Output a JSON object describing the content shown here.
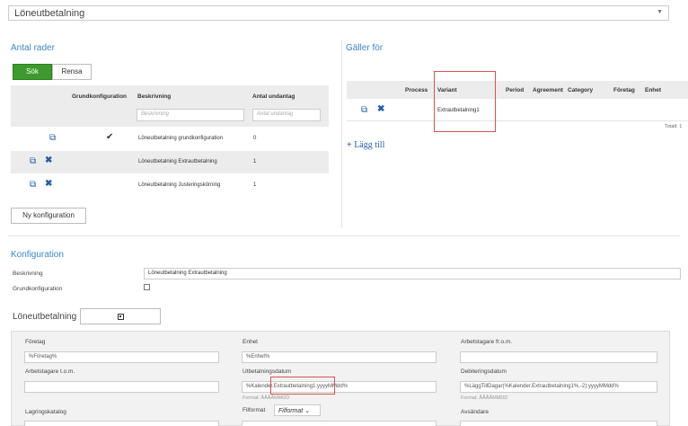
{
  "top_select": {
    "value": "Löneutbetalning"
  },
  "antal": {
    "title": "Antal rader",
    "search_label": "Sök",
    "clear_label": "Rensa",
    "headers": [
      "Grundkonfiguration",
      "Beskrivning",
      "Antal undantag"
    ],
    "placeholders": {
      "beskrivning": "Beskrivning",
      "antal": "Antal undantag"
    },
    "rows": [
      {
        "desc": "Löneutbetalning grundkonfiguration",
        "count": "0",
        "checked": true,
        "deletable": false
      },
      {
        "desc": "Löneutbetalning Extrautbetalning",
        "count": "1",
        "checked": false,
        "deletable": true
      },
      {
        "desc": "Löneutbetalning Justeringskörning",
        "count": "1",
        "checked": false,
        "deletable": true
      }
    ],
    "new_config_label": "Ny konfiguration"
  },
  "galler": {
    "title": "Gäller för",
    "headers": [
      "Process",
      "Variant",
      "Period",
      "Agreement",
      "Category",
      "Företag",
      "Enhet"
    ],
    "row_variant": "Extrautbetalning1",
    "total": "Totalt: 1",
    "add_label": "Lägg till"
  },
  "konfig": {
    "title": "Konfiguration",
    "beskrivning_label": "Beskrivning",
    "beskrivning_value": "Löneutbetalning Extrautbetalning",
    "grund_label": "Grundkonfiguration",
    "loneutbetalning_label": "Löneutbetalning"
  },
  "fields": {
    "foretag_label": "Företag",
    "foretag_value": "%Företag%",
    "enhet_label": "Enhet",
    "enhet_value": "%Enhet%",
    "arb_from_label": "Arbetstagare fr.o.m.",
    "arb_from_value": "",
    "arb_tom_label": "Arbetstagare t.o.m.",
    "arb_tom_value": "",
    "utb_label": "Utbetalningsdatum",
    "utb_value": "%Kalender.Extrautbetalning1:yyyyMMdd%",
    "utb_format": "Format: ÅÅÅÅMMDD",
    "deb_label": "Debiteringsdatum",
    "deb_value": "%LäggTillDagar(%Kalender.Extrautbetalning1%,-2):yyyyMMdd%",
    "deb_format": "Format: ÅÅÅÅMMDD",
    "lagring_label": "Lagringskatalog",
    "filformat_label": "Filformat",
    "filformat_value": "Filformat",
    "avsandare_label": "Avsändare"
  }
}
